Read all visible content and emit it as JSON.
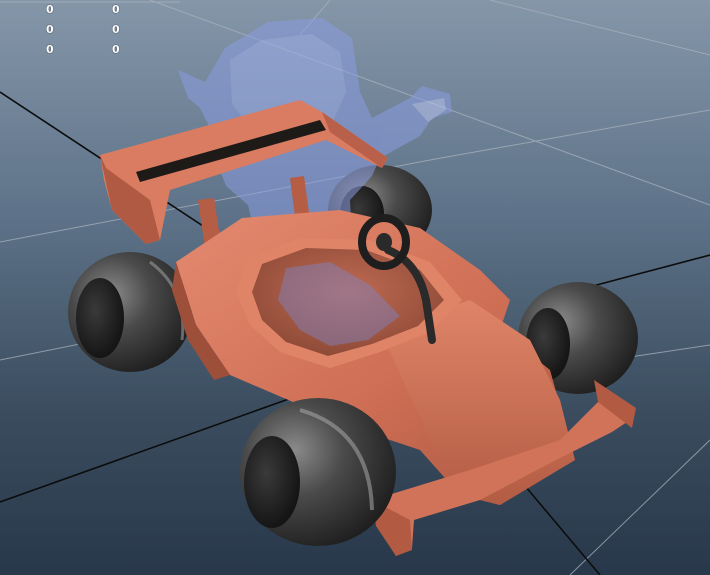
{
  "viewport": {
    "hud": {
      "rows": [
        [
          "0",
          "0"
        ],
        [
          "0",
          "0"
        ],
        [
          "0",
          "0"
        ]
      ]
    }
  },
  "colors": {
    "background_top": "#8596a9",
    "background_bottom": "#28384a",
    "grid_line": "#a0aab6",
    "grid_axis": "#0a0a0a",
    "kart_body": "#d4775e",
    "tire": "#454545",
    "ghost_driver": "#7c8dd6"
  },
  "icons": {
    "model": "go-kart-3d-model",
    "ghost": "translucent-driver-figure"
  }
}
